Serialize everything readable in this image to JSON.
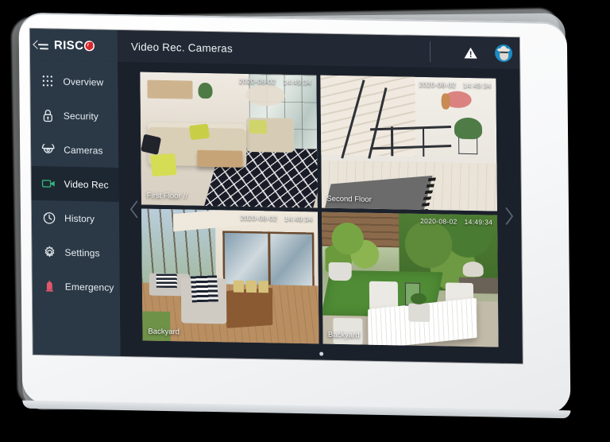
{
  "app": {
    "brand_name": "RISC",
    "brand_logo_o": "O",
    "menu_toggle_icon": "collapse-menu-icon"
  },
  "header": {
    "title": "Video Rec. Cameras",
    "warning_icon": "warning-triangle-icon",
    "avatar_icon": "user-avatar-icon"
  },
  "sidebar": {
    "items": [
      {
        "label": "Overview",
        "icon": "grid-dots-icon",
        "active": false
      },
      {
        "label": "Security",
        "icon": "lock-icon",
        "active": false
      },
      {
        "label": "Cameras",
        "icon": "dome-camera-icon",
        "active": false
      },
      {
        "label": "Video Rec",
        "icon": "video-camera-icon",
        "active": true
      },
      {
        "label": "History",
        "icon": "clock-history-icon",
        "active": false
      },
      {
        "label": "Settings",
        "icon": "gear-icon",
        "active": false
      },
      {
        "label": "Emergency",
        "icon": "alarm-bell-icon",
        "active": false
      }
    ]
  },
  "main": {
    "prev_icon": "chevron-left-icon",
    "next_icon": "chevron-right-icon",
    "page_dot_count": 1,
    "cameras": [
      {
        "name": "First Floor",
        "date": "2020-08-02",
        "time": "14:49:34",
        "badge": "//",
        "scene": "s-living"
      },
      {
        "name": "Second Floor",
        "date": "2020-08-02",
        "time": "14:49:34",
        "badge": "",
        "scene": "s-stairs"
      },
      {
        "name": "Backyard",
        "date": "2020-08-02",
        "time": "14:49:34",
        "badge": "",
        "scene": "s-patio"
      },
      {
        "name": "Backyard",
        "date": "2020-08-02",
        "time": "14:49:34",
        "badge": "",
        "scene": "s-lawn"
      }
    ]
  },
  "colors": {
    "sidebar_bg": "#2b3947",
    "header_bg": "#222834",
    "content_bg": "#1b212b",
    "active_item_bg": "#1d2732",
    "accent_green": "#35b87a",
    "brand_red": "#d8262c",
    "emergency_red": "#e4566a"
  }
}
